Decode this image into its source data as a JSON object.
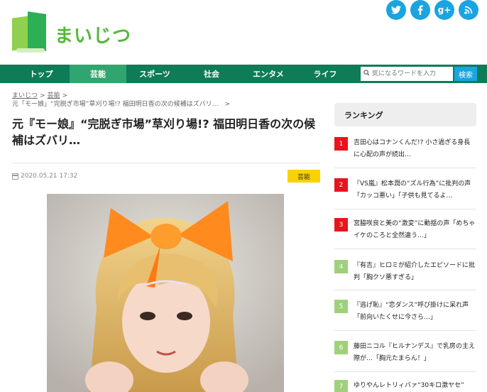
{
  "brand": {
    "name": "まいじつ"
  },
  "social": {
    "items": [
      {
        "name": "twitter-icon",
        "glyph": "t"
      },
      {
        "name": "facebook-icon",
        "glyph": "f"
      },
      {
        "name": "google-plus-icon",
        "glyph": "g+"
      },
      {
        "name": "rss-icon",
        "glyph": "◉"
      }
    ],
    "color": "#1aa4e0"
  },
  "nav": {
    "items": [
      "トップ",
      "芸能",
      "スポーツ",
      "社会",
      "エンタメ",
      "ライフ"
    ],
    "active": "芸能",
    "search_placeholder": "気になるワードを入力",
    "search_button": "検索",
    "bg_color": "#0f7b57"
  },
  "breadcrumb": {
    "items": [
      "まいじつ",
      "芸能"
    ],
    "sep": ">",
    "current": "元「モー娘」“完脱ぎ市場”草刈り場!? 福田明日香の次の候補はズバリ…"
  },
  "article": {
    "title": "元『モー娘』“完脱ぎ市場”草刈り場!? 福田明日香の次の候補はズバリ…",
    "date": "2020.05.21 17:32",
    "category": "芸能"
  },
  "ranking": {
    "heading": "ランキング",
    "items": [
      {
        "rank": "1",
        "text": "吉田心はコナンくんだ!? 小さ過ぎる身長に心配の声が続出…"
      },
      {
        "rank": "2",
        "text": "『VS嵐』松本潤の“ズル行為”に批判の声「カッコ悪い」「子供も見てるよ…"
      },
      {
        "rank": "3",
        "text": "宮脇咲良と美の“激変”に動揺の声「めちゃイケのころと全然違う…」"
      },
      {
        "rank": "4",
        "text": "『有吉』ヒロミが紹介したエピソードに批判「胸クソ悪すぎる」"
      },
      {
        "rank": "5",
        "text": "『逃げ恥』“恋ダンス”呼び掛けに呆れ声「前向いたくせに今さら…」"
      },
      {
        "rank": "6",
        "text": "藤田ニコル『ヒルナンデス』で乳房の主え際が…「胸元たまらん！」"
      },
      {
        "rank": "7",
        "text": "ゆりやんレトリィバァ“30キロ激ヤセ”"
      }
    ]
  }
}
